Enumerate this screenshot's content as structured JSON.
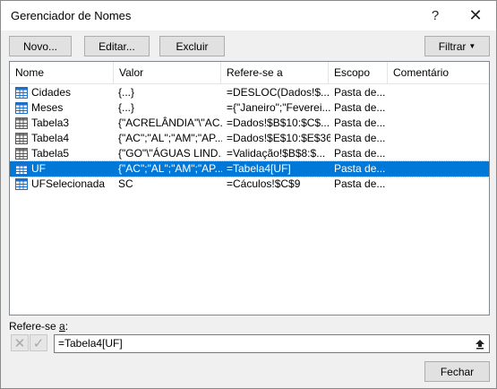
{
  "window": {
    "title": "Gerenciador de Nomes",
    "help_label": "?",
    "close_label": "✕"
  },
  "toolbar": {
    "new_label": "Novo...",
    "edit_label": "Editar...",
    "delete_label": "Excluir",
    "filter_label": "Filtrar"
  },
  "columns": [
    "Nome",
    "Valor",
    "Refere-se a",
    "Escopo",
    "Comentário"
  ],
  "rows": [
    {
      "name": "Cidades",
      "value": "{...}",
      "refers": "=DESLOC(Dados!$...",
      "scope": "Pasta de...",
      "icon": "named-range-icon"
    },
    {
      "name": "Meses",
      "value": "{...}",
      "refers": "={\"Janeiro\";\"Feverei...",
      "scope": "Pasta de...",
      "icon": "named-range-icon"
    },
    {
      "name": "Tabela3",
      "value": "{\"ACRELÂNDIA\"\\\"AC...",
      "refers": "=Dados!$B$10:$C$...",
      "scope": "Pasta de...",
      "icon": "table-icon"
    },
    {
      "name": "Tabela4",
      "value": "{\"AC\";\"AL\";\"AM\";\"AP...",
      "refers": "=Dados!$E$10:$E$36",
      "scope": "Pasta de...",
      "icon": "table-icon"
    },
    {
      "name": "Tabela5",
      "value": "{\"GO\"\\\"ÁGUAS LIND...",
      "refers": "=Validação!$B$8:$...",
      "scope": "Pasta de...",
      "icon": "table-icon"
    },
    {
      "name": "UF",
      "value": "{\"AC\";\"AL\";\"AM\";\"AP...",
      "refers": "=Tabela4[UF]",
      "scope": "Pasta de...",
      "icon": "named-range-icon",
      "selected": true
    },
    {
      "name": "UFSelecionada",
      "value": "SC",
      "refers": "=Cáculos!$C$9",
      "scope": "Pasta de...",
      "icon": "named-range-icon"
    }
  ],
  "refer": {
    "label_pre": "Refere-se ",
    "label_u": "a",
    "label_post": ":",
    "value": "=Tabela4[UF]"
  },
  "footer": {
    "close_label": "Fechar"
  },
  "colors": {
    "selection": "#0078d7",
    "icon_blue": "#1e6fc8"
  }
}
